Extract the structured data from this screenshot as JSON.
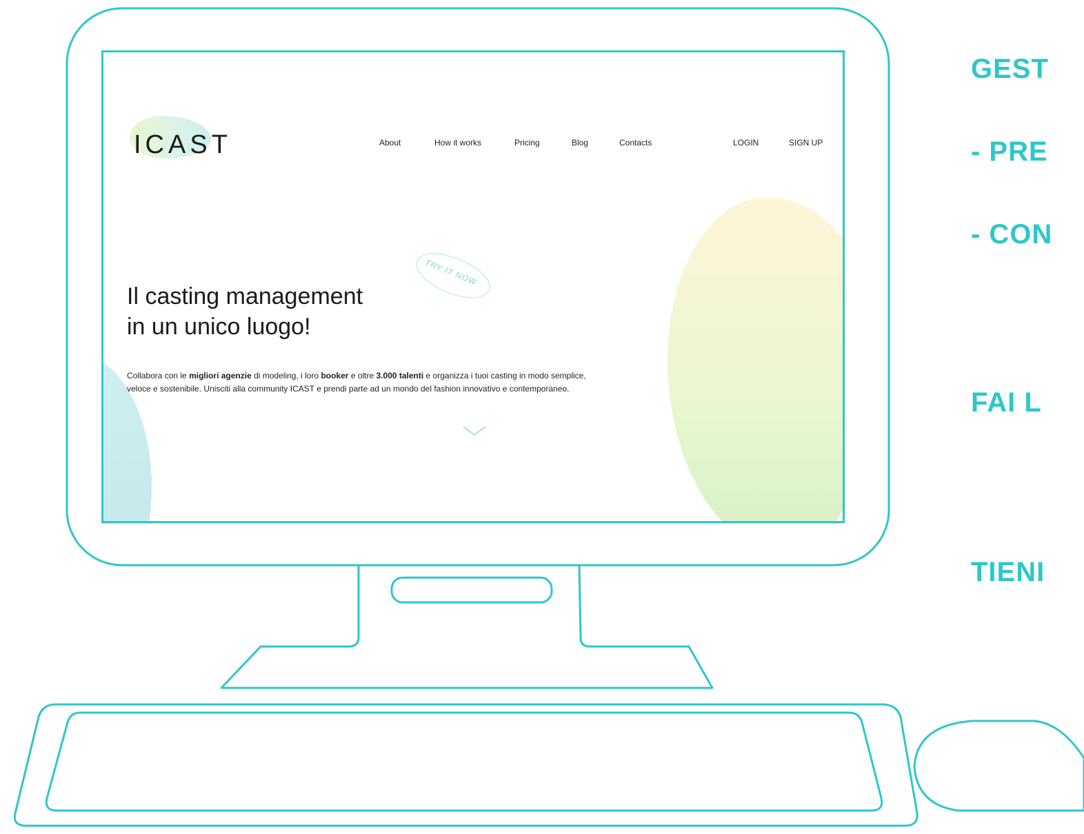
{
  "site": {
    "logo": "ICAST",
    "nav": {
      "about": "About",
      "how_it_works": "How it works",
      "pricing": "Pricing",
      "blog": "Blog",
      "contacts": "Contacts",
      "login": "LOGIN",
      "signup": "SIGN UP"
    },
    "badge": "TRY IT NOW",
    "hero": {
      "title_line1": "Il casting management",
      "title_line2": "in un unico luogo!",
      "desc_1": "Collabora con le ",
      "desc_b1": "migliori agenzie",
      "desc_2": " di modeling, i loro ",
      "desc_b2": "booker",
      "desc_3": " e oltre ",
      "desc_b3": "3.000 talenti",
      "desc_4": " e organizza i tuoi casting in modo semplice, veloce e sostenibile. Unisciti alla community ICAST e prendi parte ad un mondo del fashion innovativo e contemporaneo."
    }
  },
  "side_labels": {
    "line1": "GEST",
    "line2": "- PRE",
    "line3": "- CON",
    "line4": "FAI L",
    "line5": "TIENI"
  },
  "colors": {
    "accent": "#2ec7c9",
    "text": "#1a1a1a"
  }
}
